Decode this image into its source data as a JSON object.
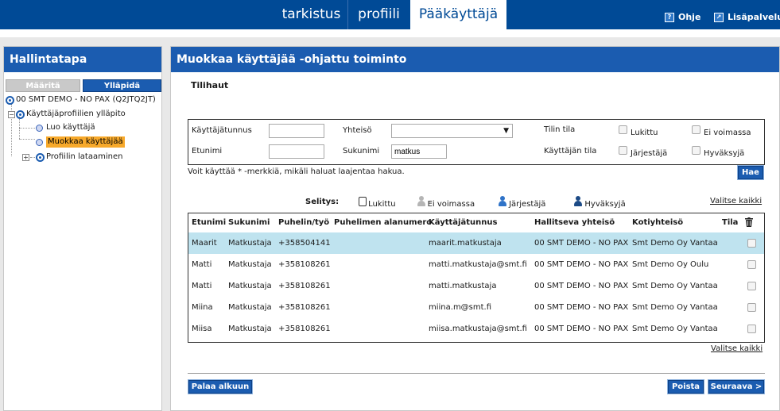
{
  "topnav": {
    "tabs": [
      "tarkistus",
      "profiili",
      "Pääkäyttäjä"
    ],
    "help_label": "Ohje",
    "services_label": "Lisäpalvelut"
  },
  "left": {
    "title": "Hallintatapa",
    "toggle_off": "Määritä",
    "toggle_on": "Ylläpidä",
    "tree": {
      "root": "00 SMT DEMO - NO PAX (Q2JTQ2JT)",
      "profiles": "Käyttäjäprofiilien ylläpito",
      "create_user": "Luo käyttäjä",
      "edit_user": "Muokkaa käyttäjää",
      "profile_load": "Profiilin lataaminen"
    }
  },
  "main": {
    "title": "Muokkaa käyttäjää -ohjattu toiminto",
    "section": "Tilihaut",
    "search": {
      "username_label": "Käyttäjätunnus",
      "username_value": "",
      "community_label": "Yhteisö",
      "community_value": "",
      "account_status_label": "Tilin tila",
      "locked_label": "Lukittu",
      "inactive_label": "Ei voimassa",
      "firstname_label": "Etunimi",
      "firstname_value": "",
      "lastname_label": "Sukunimi",
      "lastname_value": "matkus",
      "user_status_label": "Käyttäjän tila",
      "organizer_label": "Järjestäjä",
      "approver_label": "Hyväksyjä"
    },
    "hint": "Voit käyttää * -merkkiä, mikäli haluat laajentaa hakua.",
    "search_button": "Hae",
    "legend": {
      "title": "Selitys:",
      "locked": "Lukittu",
      "inactive": "Ei voimassa",
      "organizer": "Järjestäjä",
      "approver": "Hyväksyjä"
    },
    "select_all": "Valitse kaikki",
    "table": {
      "headers": [
        "Etunimi",
        "Sukunimi",
        "Puhelin/työ",
        "Puhelimen alanumero",
        "Käyttäjätunnus",
        "Hallitseva yhteisö",
        "Kotiyhteisö",
        "Tila"
      ],
      "rows": [
        [
          "Maarit",
          "Matkustaja",
          "+358504141",
          "",
          "maarit.matkustaja",
          "00 SMT DEMO - NO PAX",
          "Smt Demo Oy Vantaa"
        ],
        [
          "Matti",
          "Matkustaja",
          "+358108261",
          "",
          "matti.matkustaja@smt.fi",
          "00 SMT DEMO - NO PAX",
          "Smt Demo Oy Oulu"
        ],
        [
          "Matti",
          "Matkustaja",
          "+358108261",
          "",
          "matti.matkustaja",
          "00 SMT DEMO - NO PAX",
          "Smt Demo Oy Vantaa"
        ],
        [
          "Miina",
          "Matkustaja",
          "+358108261",
          "",
          "miina.m@smt.fi",
          "00 SMT DEMO - NO PAX",
          "Smt Demo Oy Vantaa"
        ],
        [
          "Miisa",
          "Matkustaja",
          "+358108261",
          "",
          "miisa.matkustaja@smt.fi",
          "00 SMT DEMO - NO PAX",
          "Smt Demo Oy Vantaa"
        ]
      ]
    },
    "select_all_bottom": "Valitse kaikki",
    "back_button": "Palaa alkuun",
    "delete_button": "Poista",
    "next_button": "Seuraava >"
  },
  "colors": {
    "header_blue": "#004a96",
    "panel_blue": "#1b5cb0",
    "highlight_row": "#bfe3ef",
    "selected_tree": "#f7a92b"
  }
}
